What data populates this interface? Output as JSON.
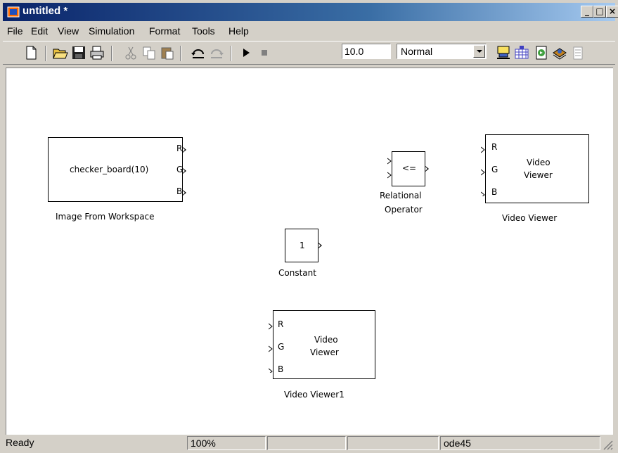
{
  "window": {
    "title": "untitled *"
  },
  "menu": [
    "File",
    "Edit",
    "View",
    "Simulation",
    "Format",
    "Tools",
    "Help"
  ],
  "toolbar": {
    "stop_time": "10.0",
    "sim_mode": "Normal",
    "icons": [
      "new-model-icon",
      "open-icon",
      "save-icon",
      "print-icon",
      "cut-icon",
      "copy-icon",
      "paste-icon",
      "undo-icon",
      "redo-icon",
      "start-simulation-icon",
      "stop-simulation-icon",
      "build-icon",
      "update-diagram-icon",
      "model-explorer-icon",
      "library-browser-icon",
      "debug-icon"
    ]
  },
  "blocks": {
    "image_from_workspace": {
      "text": "checker_board(10)",
      "ports": [
        "R",
        "G",
        "B"
      ],
      "label": "Image From Workspace"
    },
    "relational_operator": {
      "text": "<=",
      "label_line1": "Relational",
      "label_line2": "Operator"
    },
    "constant": {
      "text": "1",
      "label": "Constant"
    },
    "video_viewer": {
      "text_line1": "Video",
      "text_line2": "Viewer",
      "ports": [
        "R",
        "G",
        "B"
      ],
      "label": "Video Viewer"
    },
    "video_viewer1": {
      "text_line1": "Video",
      "text_line2": "Viewer",
      "ports": [
        "R",
        "G",
        "B"
      ],
      "label": "Video Viewer1"
    }
  },
  "status": {
    "state": "Ready",
    "zoom": "100%",
    "solver": "ode45"
  }
}
